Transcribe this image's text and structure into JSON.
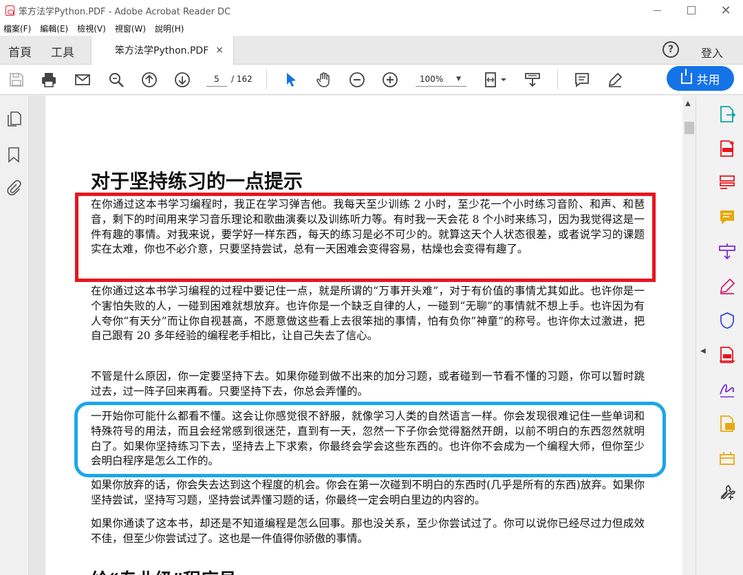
{
  "window": {
    "title": "笨方法学Python.PDF - Adobe Acrobat Reader DC"
  },
  "menu": [
    "檔案(F)",
    "編輯(E)",
    "檢視(V)",
    "視窗(W)",
    "說明(H)"
  ],
  "tabs": {
    "home": "首頁",
    "tools": "工具",
    "document": "笨方法学Python.PDF",
    "close": "×"
  },
  "header": {
    "help": "?",
    "signin": "登入"
  },
  "toolbar": {
    "current_page": "5",
    "total_pages": "/ 162",
    "zoom": "100%",
    "share_label": "共用"
  },
  "document": {
    "heading": "对于坚持练习的一点提示",
    "paragraphs": [
      "在你通过这本书学习编程时，我正在学习弹吉他。我每天至少训练 2 小时，至少花一个小时练习音阶、和声、和琶音，剩下的时间用来学习音乐理论和歌曲演奏以及训练听力等。有时我一天会花 8 个小时来练习，因为我觉得这是一件有趣的事情。对我来说，要学好一样东西，每天的练习是必不可少的。就算这天个人状态很差，或者说学习的课题实在太难，你也不必介意，只要坚持尝试，总有一天困难会变得容易，枯燥也会变得有趣了。",
      "在你通过这本书学习编程的过程中要记住一点，就是所谓的“万事开头难”，对于有价值的事情尤其如此。也许你是一个害怕失败的人，一碰到困难就想放弃。也许你是一个缺乏自律的人，一碰到“无聊”的事情就不想上手。也许因为有人夸你“有天分”而让你自视甚高，不愿意做这些看上去很笨拙的事情，怕有负你”神童”的称号。也许你太过激进，把自己跟有 20 多年经验的编程老手相比，让自己失去了信心。",
      "不管是什么原因，你一定要坚持下去。如果你碰到做不出来的加分习题，或者碰到一节看不懂的习题，你可以暂时跳过去，过一阵子回来再看。只要坚持下去，你总会弄懂的。",
      "一开始你可能什么都看不懂。这会让你感觉很不舒服，就像学习人类的自然语言一样。你会发现很难记住一些单词和特殊符号的用法，而且会经常感到很迷茫，直到有一天，忽然一下子你会觉得豁然开朗，以前不明白的东西忽然就明白了。如果你坚持练习下去，坚持去上下求索，你最终会学会这些东西的。也许你不会成为一个编程大师，但你至少会明白程序是怎么工作的。",
      "如果你放弃的话，你会失去达到这个程度的机会。你会在第一次碰到不明白的东西时(几乎是所有的东西)放弃。如果你坚持尝试，坚持写习题，坚持尝试弄懂习题的话，你最终一定会明白里边的内容的。",
      "如果你通读了这本书，却还是不知道编程是怎么回事。那也没关系，至少你尝试过了。你可以说你已经尽过力但成效不佳，但至少你尝试过了。这也是一件值得你骄傲的事情。"
    ],
    "next_heading": "给“专业级”程序员"
  },
  "colors": {
    "highlight_red": "#e8151e",
    "highlight_blue": "#1aa7e6",
    "share_blue": "#1473e6"
  }
}
